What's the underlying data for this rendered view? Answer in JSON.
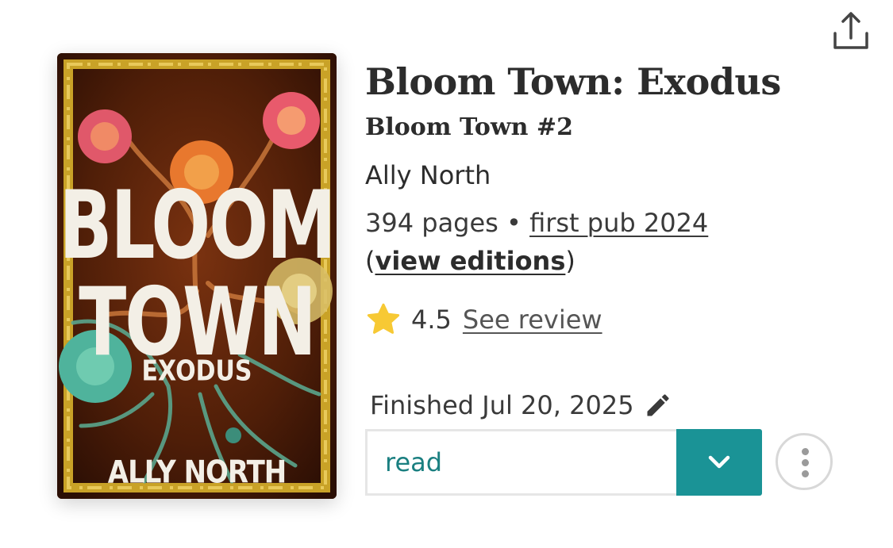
{
  "book": {
    "title": "Bloom Town: Exodus",
    "series": "Bloom Town #2",
    "author": "Ally North",
    "pages": "394 pages",
    "separator": " • ",
    "first_pub": "first pub 2024",
    "editions_open": "(",
    "editions_link": "view editions",
    "editions_close": ")"
  },
  "cover": {
    "line1": "BLOOM",
    "line2": "TOWN",
    "subtitle": "EXODUS",
    "author": "ALLY NORTH"
  },
  "rating": {
    "value": "4.5",
    "review_link": "See review",
    "icon": "star-icon"
  },
  "status": {
    "finished": "Finished Jul 20, 2025",
    "shelf": "read"
  },
  "colors": {
    "accent": "#1a9396",
    "shelf_text": "#1a7f80",
    "star": "#f7c934"
  },
  "icons": [
    "share-icon",
    "star-icon",
    "pencil-icon",
    "chevron-down-icon",
    "more-vertical-icon"
  ]
}
